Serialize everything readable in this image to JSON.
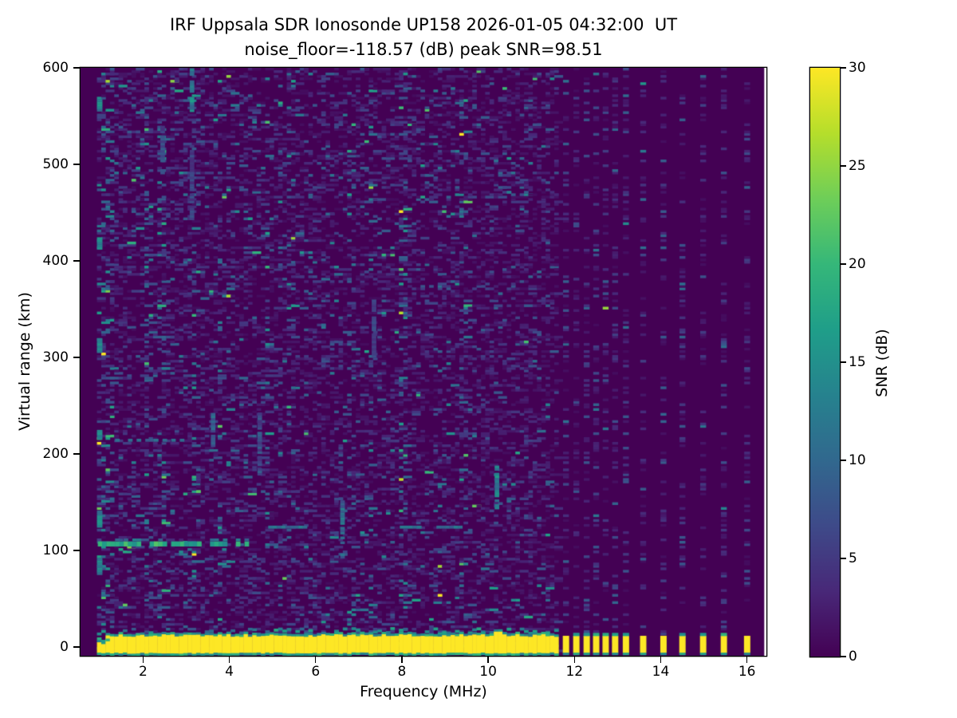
{
  "chart_data": {
    "type": "heatmap",
    "title": "IRF Uppsala SDR Ionosonde UP158 2026-01-05 04:32:00  UT",
    "subtitle": "noise_floor=-118.57 (dB) peak SNR=98.51",
    "station": "UP158",
    "timestamp_ut": "2026-01-05 04:32:00",
    "noise_floor_db": -118.57,
    "peak_snr_db": 98.51,
    "xlabel": "Frequency (MHz)",
    "ylabel": "Virtual range (km)",
    "xlim": [
      0.55,
      16.45
    ],
    "ylim": [
      -9,
      600
    ],
    "x_ticks": [
      2,
      4,
      6,
      8,
      10,
      12,
      14,
      16
    ],
    "y_ticks": [
      0,
      100,
      200,
      300,
      400,
      500,
      600
    ],
    "grid": false,
    "colorbar": {
      "label": "SNR (dB)",
      "min": 0,
      "max": 30,
      "ticks": [
        0,
        5,
        10,
        15,
        20,
        25,
        30
      ],
      "colormap": "viridis"
    },
    "colormap_stops": [
      "#440154",
      "#482878",
      "#3e4a89",
      "#31688e",
      "#26828e",
      "#1f9e89",
      "#35b779",
      "#6ece58",
      "#b5de2b",
      "#fde725"
    ],
    "data_extent_mhz": [
      0.93,
      16.4
    ],
    "sweep": {
      "start_mhz": 0.93,
      "continuous_sweep_end_mhz": 11.62,
      "freq_step_mhz": 0.1,
      "range_bin_km": 2.5,
      "stepped_frequencies_mhz": [
        11.8,
        12.04,
        12.28,
        12.5,
        12.72,
        12.94,
        13.19,
        13.59,
        14.06,
        14.5,
        14.98,
        15.46,
        16.0
      ]
    },
    "features": {
      "ground_echo_band": {
        "freq_range_mhz": [
          0.93,
          11.62
        ],
        "range_km": [
          -6,
          12
        ],
        "snr_db": 30
      },
      "e_region_echo": {
        "range_km": 107,
        "freq_range_mhz": [
          0.95,
          4.4
        ],
        "gap_mhz": [
          3.28,
          3.5
        ],
        "snr_db": 18
      },
      "echo_125km": {
        "range_km": 125,
        "segments_mhz": [
          [
            4.9,
            5.85
          ],
          [
            7.95,
            8.4
          ],
          [
            8.8,
            9.3
          ]
        ],
        "snr_db": 11
      },
      "echo_215km": {
        "range_km": 215,
        "freq_range_mhz": [
          1.35,
          2.9
        ],
        "snr_db": 10
      },
      "interference_streaks": [
        {
          "freq_mhz": 3.08,
          "range_km": [
            552,
            598
          ],
          "snr_db": 13
        },
        {
          "freq_mhz": 3.08,
          "range_km": [
            440,
            520
          ],
          "snr_db": 6
        },
        {
          "freq_mhz": 6.57,
          "range_km": [
            92,
            150
          ],
          "snr_db": 11
        },
        {
          "freq_mhz": 10.15,
          "range_km": [
            143,
            188
          ],
          "snr_db": 13
        },
        {
          "freq_mhz": 4.65,
          "range_km": [
            178,
            242
          ],
          "snr_db": 7
        },
        {
          "freq_mhz": 3.57,
          "range_km": [
            205,
            242
          ],
          "snr_db": 9
        },
        {
          "freq_mhz": 2.4,
          "range_km": [
            490,
            540
          ],
          "snr_db": 7
        },
        {
          "freq_mhz": 7.3,
          "range_km": [
            300,
            360
          ],
          "snr_db": 6
        }
      ],
      "first_column_spots_km": [
        [
          555,
          566
        ],
        [
          412,
          424
        ],
        [
          305,
          318
        ],
        [
          215,
          224
        ],
        [
          124,
          140
        ],
        [
          75,
          92
        ]
      ]
    },
    "noise": {
      "background_db": 0,
      "speckle_density": 0.42,
      "speckle_mean_db": 2.2,
      "stepped_column_density": 0.34,
      "seed": 20260105
    }
  }
}
